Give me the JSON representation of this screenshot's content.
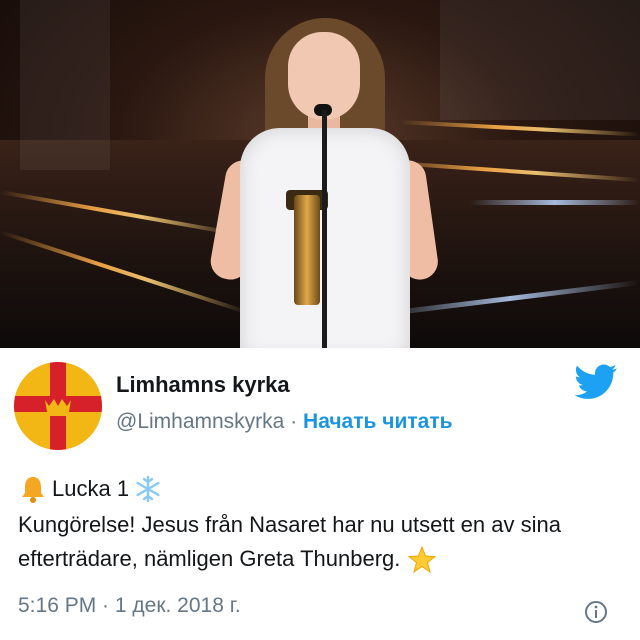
{
  "tweet": {
    "display_name": "Limhamns kyrka",
    "handle": "@Limhamnskyrka",
    "separator": "·",
    "follow_label": "Начать читать",
    "first_line_text": "Lucka 1",
    "body": "Kungörelse! Jesus från Nasaret har nu utsett en av sina efterträdare, nämligen Greta Thunberg.",
    "timestamp": "5:16 PM · 1 дек. 2018 г."
  },
  "icons": {
    "bell": "bell-icon",
    "snowflake": "snowflake-icon",
    "star": "glowing-star-icon",
    "bird": "twitter-bird-icon",
    "info": "info-icon",
    "avatar_emblem": "church-cross-crown-emblem"
  },
  "colors": {
    "twitter_blue": "#1da1f2",
    "follow_blue": "#1b95e0",
    "muted_text": "#657786",
    "main_text": "#14171a",
    "avatar_cross_red": "#d6202a",
    "avatar_yellow": "#f2b615"
  }
}
